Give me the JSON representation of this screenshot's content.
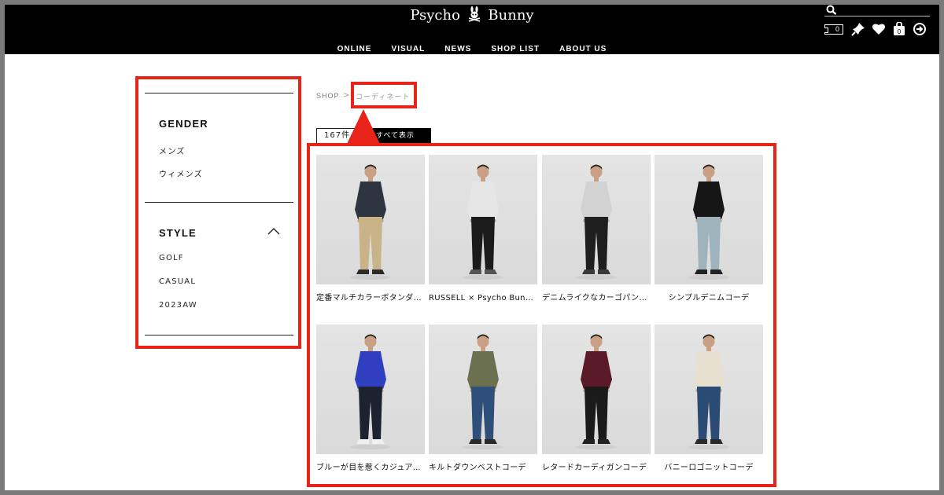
{
  "brand": {
    "name_left": "Psycho",
    "name_right": "Bunny"
  },
  "nav": [
    "ONLINE",
    "VISUAL",
    "NEWS",
    "SHOP LIST",
    "ABOUT US"
  ],
  "header_icons": {
    "search": "search-icon",
    "cart_count": "0",
    "icons": [
      "pin-icon",
      "heart-icon",
      "bag-icon",
      "logout-icon"
    ]
  },
  "sidebar": {
    "gender": {
      "title": "GENDER",
      "items": [
        "メンズ",
        "ウィメンズ"
      ]
    },
    "style": {
      "title": "STYLE",
      "items": [
        "GOLF",
        "CASUAL",
        "2023AW"
      ]
    }
  },
  "breadcrumb": {
    "root": "SHOP",
    "separator": ">",
    "current": "コーディネート"
  },
  "results": {
    "count": "167件",
    "show_all": "すべて表示"
  },
  "products": [
    {
      "caption": "定番マルチカラーボタンダウンシャツ",
      "top": "#2f3540",
      "bottom": "#c9b48a",
      "shoes": "#2b2b2b"
    },
    {
      "caption": "RUSSELL × Psycho Bunnyスウェットコーデ",
      "top": "#e6e6e6",
      "bottom": "#1b1b1b",
      "shoes": "#555555"
    },
    {
      "caption": "デニムライクなカーゴパンツコーデ",
      "top": "#d2d2d2",
      "bottom": "#1e1e1e",
      "shoes": "#3a3a3a"
    },
    {
      "caption": "シンプルデニムコーデ",
      "top": "#161616",
      "bottom": "#9fb3bd",
      "shoes": "#222222"
    },
    {
      "caption": "ブルーが目を惹くカジュアルコーデ",
      "top": "#2f3fbf",
      "bottom": "#1c2230",
      "shoes": "#f0f0f0"
    },
    {
      "caption": "キルトダウンベストコーデ",
      "top": "#6b7150",
      "bottom": "#2e4f7a",
      "shoes": "#2a2a2a"
    },
    {
      "caption": "レタードカーディガンコーデ",
      "top": "#5a1a2a",
      "bottom": "#1a1a1a",
      "shoes": "#222222"
    },
    {
      "caption": "バニーロゴニットコーデ",
      "top": "#e7dfcf",
      "bottom": "#2c4b74",
      "shoes": "#2a2a2a"
    }
  ],
  "colors": {
    "highlight": "#e8231a",
    "header_bg": "#000000"
  }
}
